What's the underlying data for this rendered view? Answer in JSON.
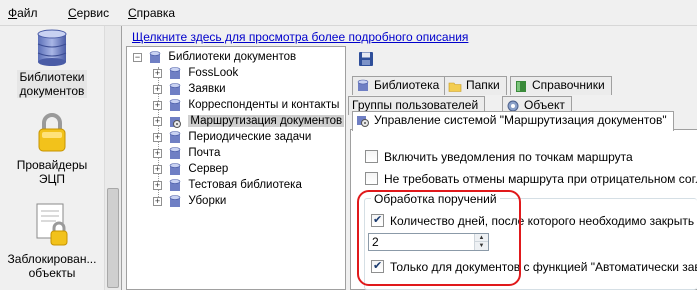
{
  "menu": {
    "file": "Файл",
    "file_hotkey": "Ф",
    "file_rest": "айл",
    "service_hotkey": "С",
    "service_rest": "ервис",
    "help_hotkey": "С",
    "help_rest": "правка"
  },
  "nav": {
    "items": [
      {
        "label": "Библиотеки документов",
        "label_line1": "Библиотеки",
        "label_line2": "документов",
        "icon": "database-icon"
      },
      {
        "label_line1": "Провайдеры",
        "label_line2": "ЭЦП",
        "icon": "padlock-icon"
      },
      {
        "label_line1": "Заблокирован...",
        "label_line2": "объекты",
        "icon": "locked-document-icon"
      }
    ]
  },
  "link_text": "Щелкните здесь для просмотра более подробного описания",
  "tree": {
    "root": "Библиотеки документов",
    "items": [
      {
        "label": "FossLook",
        "icon": "database-icon"
      },
      {
        "label": "Заявки",
        "icon": "database-icon"
      },
      {
        "label": "Корреспонденты и контакты",
        "icon": "database-icon"
      },
      {
        "label": "Маршрутизация документов",
        "icon": "routing-icon",
        "selected": true
      },
      {
        "label": "Периодические задачи",
        "icon": "database-icon"
      },
      {
        "label": "Почта",
        "icon": "database-icon"
      },
      {
        "label": "Сервер",
        "icon": "database-icon"
      },
      {
        "label": "Тестовая библиотека",
        "icon": "database-icon"
      },
      {
        "label": "Уборки",
        "icon": "database-icon"
      }
    ]
  },
  "tabs": {
    "row1": [
      {
        "label": "Библиотека",
        "icon": "database-icon"
      },
      {
        "label": "Папки",
        "icon": "folder-icon"
      },
      {
        "label": "Справочники",
        "icon": "book-icon"
      }
    ],
    "row2": [
      {
        "label": "Группы пользователей"
      },
      {
        "label": "Объект",
        "icon": "gear-icon"
      }
    ],
    "active": {
      "label": "Управление системой \"Маршрутизация документов\"",
      "icon": "routing-icon"
    }
  },
  "options": {
    "opt1": {
      "label": "Включить уведомления по точкам маршрута",
      "checked": false
    },
    "opt2": {
      "label": "Не требовать отмены маршрута при отрицательном согласовании",
      "checked": false
    },
    "group_title": "Обработка поручений",
    "opt3": {
      "label": "Количество дней, после которого необходимо закрыть поручение",
      "checked": true
    },
    "days_value": "2",
    "opt4": {
      "label": "Только для документов с функцией \"Автоматически завершать\"",
      "checked": true
    }
  },
  "colors": {
    "highlight": "#e0191b",
    "link": "#0000cc",
    "selected_bg": "#cfcfcf"
  }
}
